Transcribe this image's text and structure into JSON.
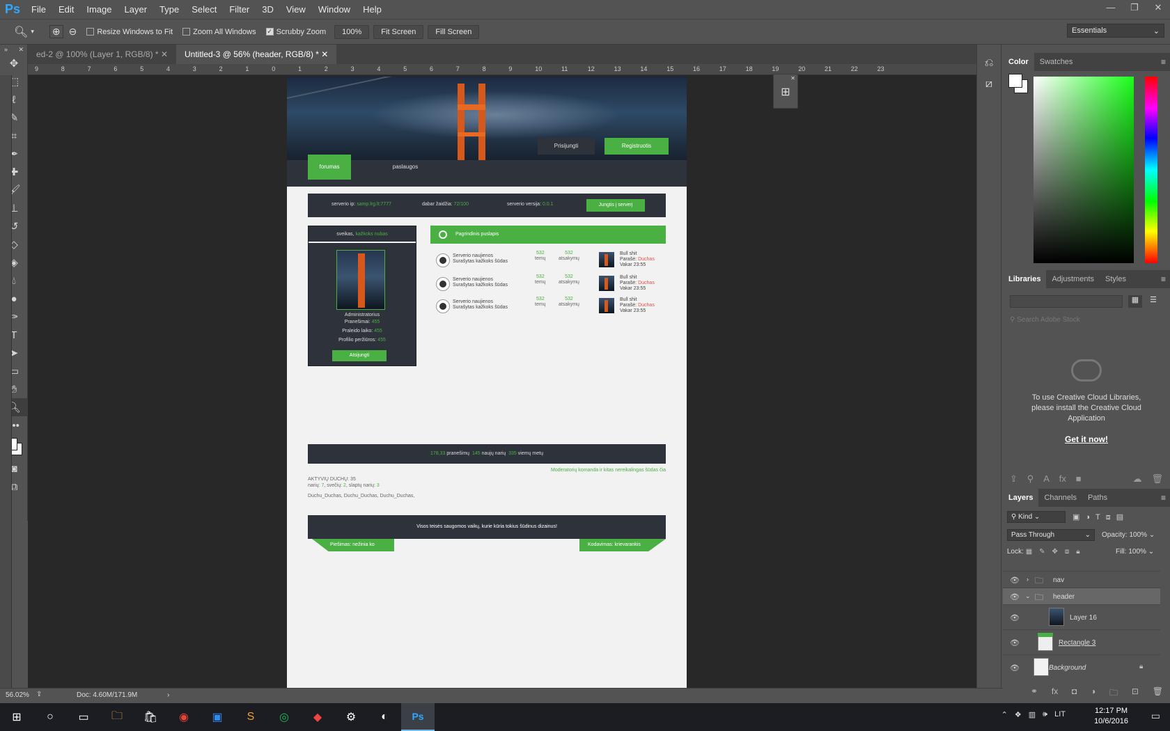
{
  "app": {
    "logo": "Ps"
  },
  "menu": [
    "File",
    "Edit",
    "Image",
    "Layer",
    "Type",
    "Select",
    "Filter",
    "3D",
    "View",
    "Window",
    "Help"
  ],
  "options": {
    "resize_windows": "Resize Windows to Fit",
    "zoom_all": "Zoom All Windows",
    "scrubby": "Scrubby Zoom",
    "zoom_value": "100%",
    "fit_screen": "Fit Screen",
    "fill_screen": "Fill Screen",
    "workspace": "Essentials"
  },
  "tabs": [
    {
      "label": "ed-2 @ 100% (Layer 1, RGB/8) *"
    },
    {
      "label": "Untitled-3 @ 56% (header, RGB/8) *"
    }
  ],
  "ruler_numbers": [
    "9",
    "8",
    "7",
    "6",
    "5",
    "4",
    "3",
    "2",
    "1",
    "0",
    "1",
    "2",
    "3",
    "4",
    "5",
    "6",
    "7",
    "8",
    "9",
    "10",
    "11",
    "12",
    "13",
    "14",
    "15",
    "16",
    "17",
    "18",
    "19",
    "20",
    "21",
    "22",
    "23"
  ],
  "design": {
    "login": "Prisijungti",
    "register": "Registruotis",
    "nav_forum": "forumas",
    "nav_services": "paslaugos",
    "server_ip_label": "serverio ip:",
    "server_ip": "samp.lrg.lt:7777",
    "players_label": "dabar žaidžia:",
    "players": "72/100",
    "version_label": "serverio versija:",
    "version": "0.0.1",
    "join_btn": "Jungtis į serverį",
    "greeting": "sveikas,",
    "username": "kažkoks nubas",
    "role": "Administratorius",
    "posts_label": "Pranešimai:",
    "posts": "455",
    "time_label": "Praleido laiko:",
    "time": "455",
    "views_label": "Profilio peržiūros:",
    "views": "455",
    "logout_btn": "Atsijungti",
    "main_title": "Pagrindinis puslapis",
    "forum_rows": [
      {
        "title": "Serverio naujienos",
        "desc": "Surašytas kažkoks šūdas",
        "topics": "532",
        "topics_label": "temų",
        "replies": "532",
        "replies_label": "atsakymų",
        "last_title": "Bull shit",
        "last_by_label": "Parašė:",
        "last_by": "Duchas",
        "last_time": "Vakar 23:55"
      },
      {
        "title": "Serverio naujienos",
        "desc": "Surašytas kažkoks šūdas",
        "topics": "532",
        "topics_label": "temų",
        "replies": "532",
        "replies_label": "atsakymų",
        "last_title": "Bull shit",
        "last_by_label": "Parašė:",
        "last_by": "Duchas",
        "last_time": "Vakar 23:55"
      },
      {
        "title": "Serverio naujienos",
        "desc": "Surašytas kažkoks šūdas",
        "topics": "532",
        "topics_label": "temų",
        "replies": "532",
        "replies_label": "atsakymų",
        "last_title": "Bull shit",
        "last_by_label": "Parašė:",
        "last_by": "Duchas",
        "last_time": "Vakar 23:55"
      }
    ],
    "stat_posts": "178,33",
    "stat_posts_label": "pranešimų",
    "stat_members": "145",
    "stat_members_label": "naujų narių",
    "stat_views": "335",
    "stat_views_label": "viemų metų",
    "mod_team": "Moderatorių komanda ir kitas nereikalingas šūdas čia",
    "online_title": "AKTYVIŲ DUCHŲ: 35",
    "online_counts_1": "narių:",
    "online_members": "7",
    "online_counts_2": ", svečių:",
    "online_guests": "2",
    "online_counts_3": ", slaptų narių:",
    "online_hidden": "3",
    "online_names": "Duchu_Duchas, Duchu_Duchas, Duchu_Duchas,",
    "footer_text": "Visos teisės saugomos vaikų, kurie kūria tokius šūdinus dizainus!",
    "foot_left": "Piešimas: nežinia ko",
    "foot_right": "Kodavimas: krievarankis"
  },
  "panels": {
    "color_tabs": [
      "Color",
      "Swatches"
    ],
    "lib_tabs": [
      "Libraries",
      "Adjustments",
      "Styles"
    ],
    "lib_search": "Search Adobe Stock",
    "lib_msg": "To use Creative Cloud Libraries, please install the Creative Cloud Application",
    "lib_get": "Get it now!",
    "layer_tabs": [
      "Layers",
      "Channels",
      "Paths"
    ],
    "kind": "Kind",
    "blend": "Pass Through",
    "opacity_label": "Opacity:",
    "opacity": "100%",
    "lock_label": "Lock:",
    "fill_label": "Fill:",
    "fill": "100%",
    "layers": [
      "nav",
      "header",
      "Layer 16",
      "Rectangle 3",
      "Background"
    ]
  },
  "status": {
    "zoom": "56.02%",
    "doc": "Doc: 4.60M/171.9M"
  },
  "taskbar": {
    "time": "12:17 PM",
    "date": "10/6/2016",
    "lang": "LIT"
  },
  "colors": {
    "accent_green": "#4ab043",
    "ps_blue": "#31a8ff",
    "dark_panel": "#2e323a"
  }
}
